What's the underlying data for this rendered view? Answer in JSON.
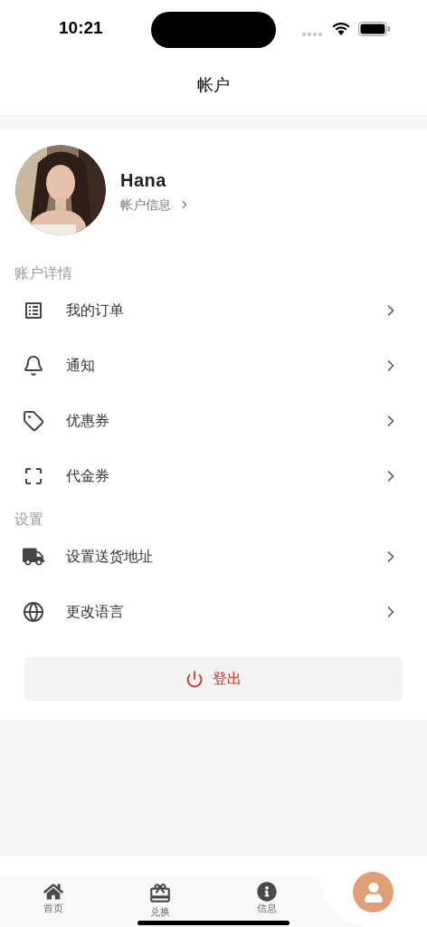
{
  "status_bar": {
    "time": "10:21"
  },
  "header": {
    "title": "帐户"
  },
  "profile": {
    "name": "Hana",
    "link": "帐户信息"
  },
  "sections": [
    {
      "heading": "账户详情",
      "items": [
        {
          "label": "我的订单"
        },
        {
          "label": "通知"
        },
        {
          "label": "优惠券"
        },
        {
          "label": "代金券"
        }
      ]
    },
    {
      "heading": "设置",
      "items": [
        {
          "label": "设置送货地址"
        },
        {
          "label": "更改语言"
        }
      ]
    }
  ],
  "logout_button": {
    "label": "登出"
  },
  "tab_bar": [
    {
      "label": "首页",
      "selected": false
    },
    {
      "label": "兑换",
      "selected": false
    },
    {
      "label": "信息",
      "selected": false
    },
    {
      "selected": true
    }
  ]
}
